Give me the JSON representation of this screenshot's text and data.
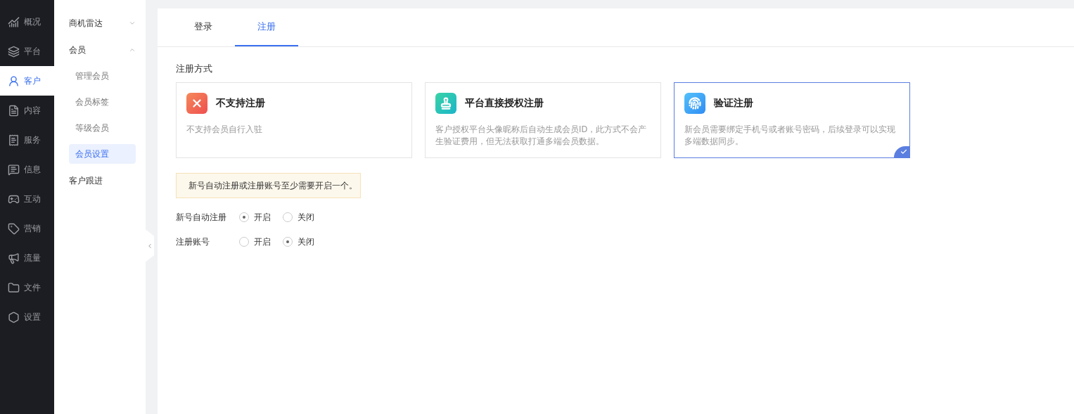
{
  "rail": [
    {
      "label": "概况",
      "selected": false
    },
    {
      "label": "平台",
      "selected": false
    },
    {
      "label": "客户",
      "selected": true
    },
    {
      "label": "内容",
      "selected": false
    },
    {
      "label": "服务",
      "selected": false
    },
    {
      "label": "信息",
      "selected": false
    },
    {
      "label": "互动",
      "selected": false
    },
    {
      "label": "营销",
      "selected": false
    },
    {
      "label": "流量",
      "selected": false
    },
    {
      "label": "文件",
      "selected": false
    },
    {
      "label": "设置",
      "selected": false
    }
  ],
  "submenu": [
    {
      "label": "商机雷达",
      "expanded": false
    },
    {
      "label": "会员",
      "expanded": true,
      "children": [
        {
          "label": "管理会员",
          "selected": false
        },
        {
          "label": "会员标签",
          "selected": false
        },
        {
          "label": "等级会员",
          "selected": false
        },
        {
          "label": "会员设置",
          "selected": true
        }
      ]
    },
    {
      "label": "客户跟进"
    }
  ],
  "tabs": [
    {
      "label": "登录",
      "selected": false
    },
    {
      "label": "注册",
      "selected": true
    }
  ],
  "section_title": "注册方式",
  "methods": [
    {
      "kind": "none",
      "title": "不支持注册",
      "description": "不支持会员自行入驻",
      "selected": false
    },
    {
      "kind": "platform",
      "title": "平台直接授权注册",
      "description": "客户授权平台头像昵称后自动生成会员ID，此方式不会产生验证费用，但无法获取打通多端会员数据。",
      "selected": false
    },
    {
      "kind": "verify",
      "title": "验证注册",
      "description": "新会员需要绑定手机号或者账号密码，后续登录可以实现多端数据同步。",
      "selected": true
    }
  ],
  "notice": "新号自动注册或注册账号至少需要开启一个。",
  "settings": [
    {
      "label": "新号自动注册",
      "options": [
        {
          "label": "开启",
          "selected": true
        },
        {
          "label": "关闭",
          "selected": false
        }
      ]
    },
    {
      "label": "注册账号",
      "options": [
        {
          "label": "开启",
          "selected": false
        },
        {
          "label": "关闭",
          "selected": true
        }
      ]
    }
  ]
}
